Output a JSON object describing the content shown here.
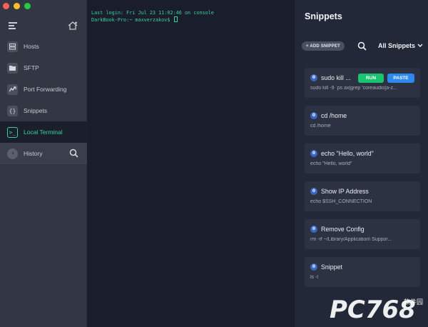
{
  "window": {
    "traffic_colors": [
      "#fe5f57",
      "#febc2e",
      "#28c840"
    ]
  },
  "sidebar": {
    "items": [
      {
        "label": "Hosts",
        "icon": "server-icon"
      },
      {
        "label": "SFTP",
        "icon": "folder-icon"
      },
      {
        "label": "Port Forwarding",
        "icon": "port-forward-icon"
      },
      {
        "label": "Snippets",
        "icon": "braces-icon"
      },
      {
        "label": "Local Terminal",
        "icon": "terminal-icon",
        "active": true
      },
      {
        "label": "History",
        "icon": "clock-icon"
      }
    ]
  },
  "terminal": {
    "line1": "Last login: Fri Jul 23 11:02:46 on console",
    "line2": "DarkBook-Pro:~ maxverzakov$"
  },
  "snippets": {
    "title": "Snippets",
    "add_label": "+ ADD SNIPPET",
    "filter_label": "All Snippets",
    "run_label": "RUN",
    "paste_label": "PASTE",
    "items": [
      {
        "title": "sudo kill ...",
        "command": "sudo kill -9 `ps ax|grep 'coreaudio[a-z...",
        "badge": "0"
      },
      {
        "title": "cd /home",
        "command": "cd /home",
        "badge": "0"
      },
      {
        "title": "echo \"Hello, world\"",
        "command": "echo \"Hello, world\"",
        "badge": "0"
      },
      {
        "title": "Show IP Address",
        "command": "echo $SSH_CONNECTION",
        "badge": "0"
      },
      {
        "title": "Remove Config",
        "command": "rm -rf ~/Library/Application\\ Suppor...",
        "badge": "0"
      },
      {
        "title": "Snippet",
        "command": "ls -l",
        "badge": "0"
      }
    ]
  },
  "watermark": {
    "text": "PC768",
    "sub": "软件园",
    "color": "#ffffff"
  },
  "colors": {
    "accent_green": "#3ad29f",
    "run_green": "#19c36f",
    "paste_blue": "#2d88f0"
  }
}
